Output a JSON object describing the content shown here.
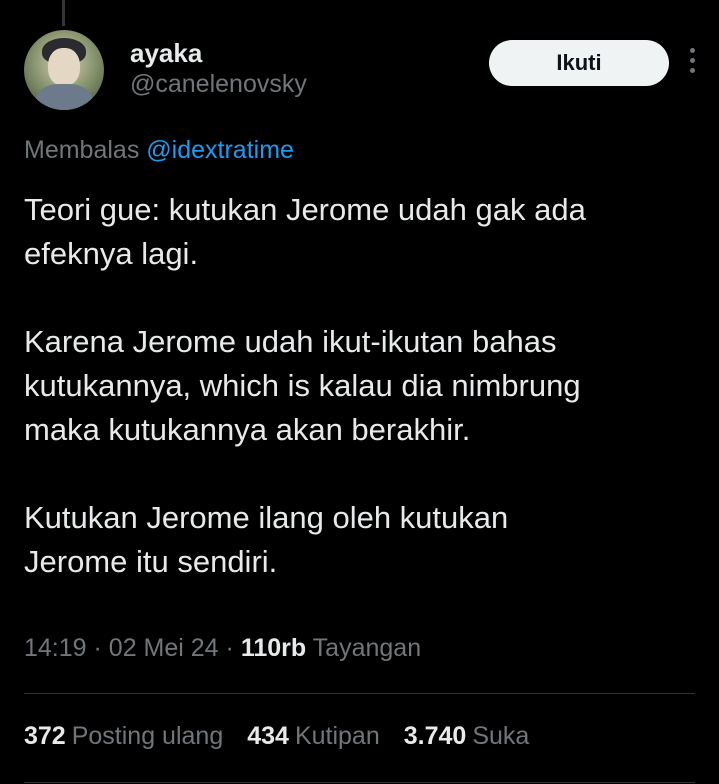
{
  "user": {
    "display_name": "ayaka",
    "handle": "@canelenovsky"
  },
  "follow_button": {
    "label": "Ikuti"
  },
  "reply": {
    "prefix": "Membalas",
    "mention": "@idextratime"
  },
  "tweet": {
    "lines": [
      "Teori gue: kutukan Jerome udah gak ada",
      "efeknya lagi.",
      "",
      "Karena Jerome udah ikut-ikutan bahas",
      "kutukannya, which is kalau dia nimbrung",
      "maka kutukannya akan berakhir.",
      "",
      "Kutukan Jerome ilang oleh kutukan",
      "Jerome itu sendiri."
    ]
  },
  "meta": {
    "time": "14:19",
    "date": "02 Mei 24",
    "views_count": "110rb",
    "views_label": "Tayangan"
  },
  "stats": {
    "reposts_count": "372",
    "reposts_label": "Posting ulang",
    "quotes_count": "434",
    "quotes_label": "Kutipan",
    "likes_count": "3.740",
    "likes_label": "Suka"
  },
  "colors": {
    "background": "#000000",
    "text": "#e7e9ea",
    "secondary_text": "#71767b",
    "link": "#1d9bf0",
    "button_bg": "#eff3f4"
  }
}
